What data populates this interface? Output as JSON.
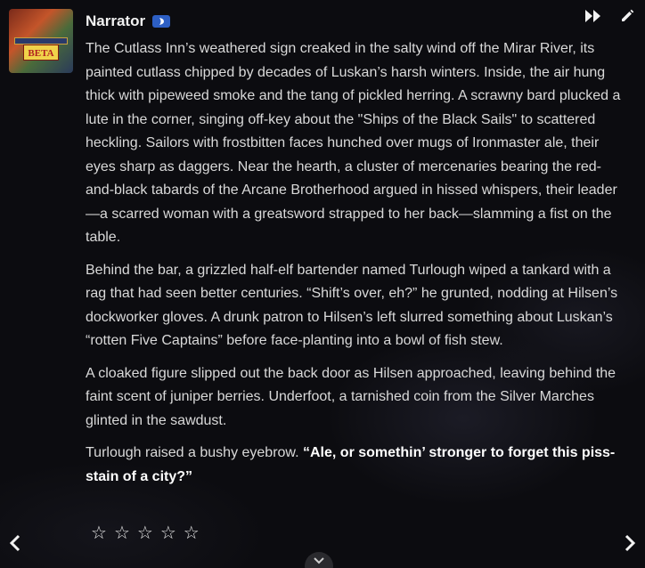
{
  "character": {
    "name": "Narrator",
    "badge_icon": "bot-badge-icon",
    "avatar_logo_text": "BETA"
  },
  "toolbar": {
    "icons": [
      "fast-forward-icon",
      "edit-pencil-icon"
    ]
  },
  "message": {
    "paragraphs": [
      "The Cutlass Inn’s weathered sign creaked in the salty wind off the Mirar River, its painted cutlass chipped by decades of Luskan’s harsh winters. Inside, the air hung thick with pipeweed smoke and the tang of pickled herring. A scrawny bard plucked a lute in the corner, singing off-key about the \"Ships of the Black Sails\" to scattered heckling. Sailors with frostbitten faces hunched over mugs of Ironmaster ale, their eyes sharp as daggers. Near the hearth, a cluster of mercenaries bearing the red-and-black tabards of the Arcane Brotherhood argued in hissed whispers, their leader—a scarred woman with a greatsword strapped to her back—slamming a fist on the table.",
      "Behind the bar, a grizzled half-elf bartender named Turlough wiped a tankard with a rag that had seen better centuries. “Shift’s over, eh?” he grunted, nodding at Hilsen’s dockworker gloves. A drunk patron to Hilsen’s left slurred something about Luskan’s “rotten Five Captains” before face-planting into a bowl of fish stew.",
      "A cloaked figure slipped out the back door as Hilsen approached, leaving behind the faint scent of juniper berries. Underfoot, a tarnished coin from the Silver Marches glinted in the sawdust."
    ],
    "last_paragraph_lead": "Turlough raised a bushy eyebrow. ",
    "last_paragraph_quote": "“Ale, or somethin’ stronger to forget this piss-stain of a city?”"
  },
  "rating": {
    "max": 5,
    "value": 0,
    "star_glyph": "☆"
  },
  "colors": {
    "background": "#0c0c10",
    "text": "#d9d9d9",
    "badge": "#2d5fc4"
  }
}
